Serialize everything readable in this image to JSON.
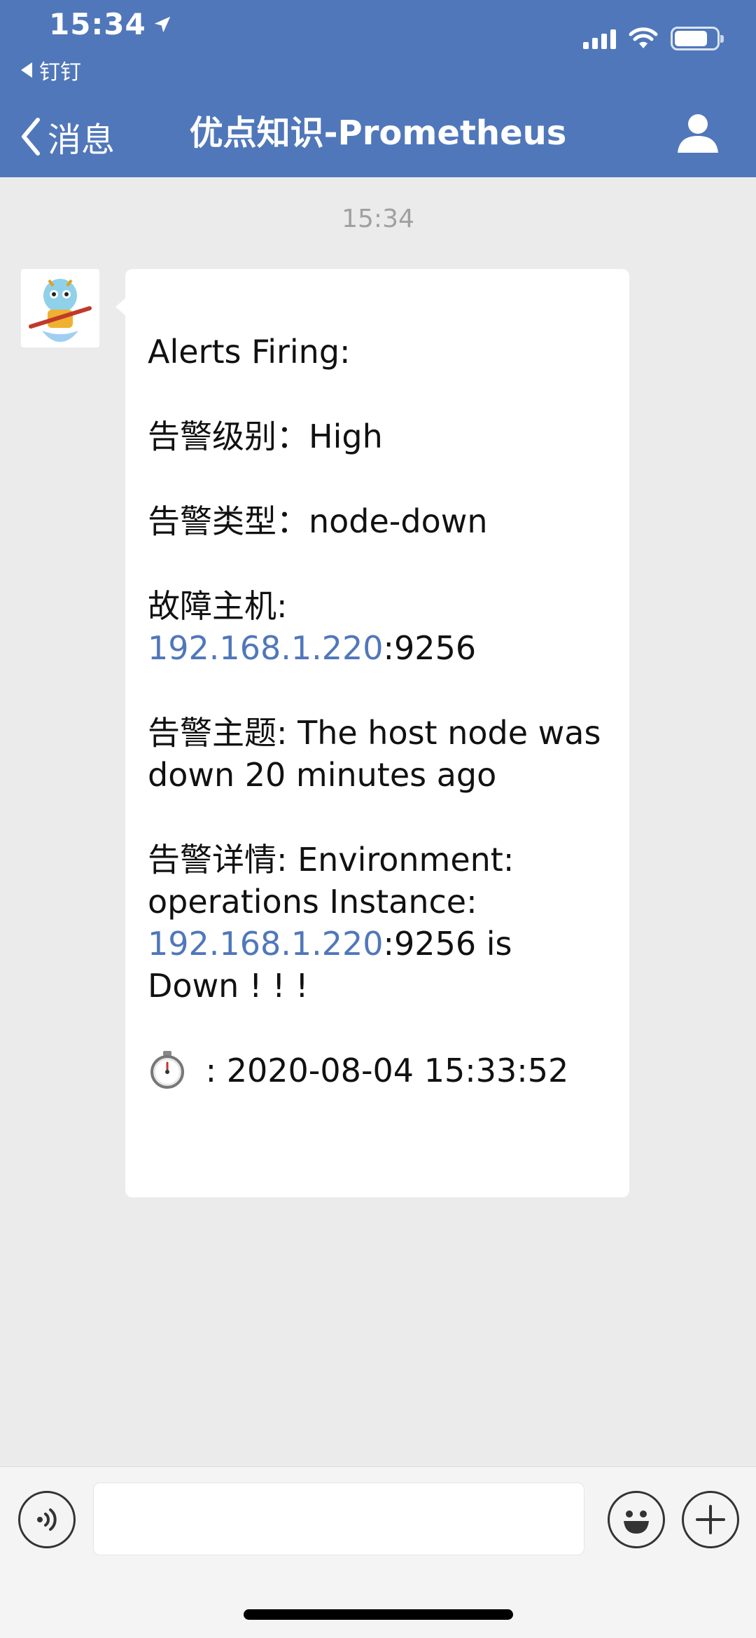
{
  "status_bar": {
    "time": "15:34",
    "back_app": "钉钉"
  },
  "nav": {
    "back_label": "消息",
    "title": "优点知识-Prometheus"
  },
  "chat": {
    "timestamp": "15:34",
    "message": {
      "header": "Alerts Firing:",
      "level_label": "告警级别：",
      "level_value": "High",
      "type_label": "告警类型：",
      "type_value": "node-down",
      "host_label": "故障主机:",
      "host_ip": "192.168.1.220",
      "host_port": ":9256",
      "subject_label": "告警主题:",
      "subject_value": " The host node was down 20 minutes ago",
      "detail_label": "告警详情:",
      "detail_value_1": " Environment: operations Instance:",
      "detail_ip": "192.168.1.220",
      "detail_value_2": ":9256 is Down ! ! !",
      "time_value": " : 2020-08-04 15:33:52"
    }
  },
  "icons": [
    "location-arrow-icon",
    "signal-icon",
    "wifi-icon",
    "battery-icon",
    "chevron-left-icon",
    "profile-icon",
    "voice-icon",
    "emoji-icon",
    "plus-icon",
    "stopwatch-icon"
  ],
  "colors": {
    "header": "#5077ba",
    "link": "#5077ba",
    "background": "#ebebeb"
  }
}
